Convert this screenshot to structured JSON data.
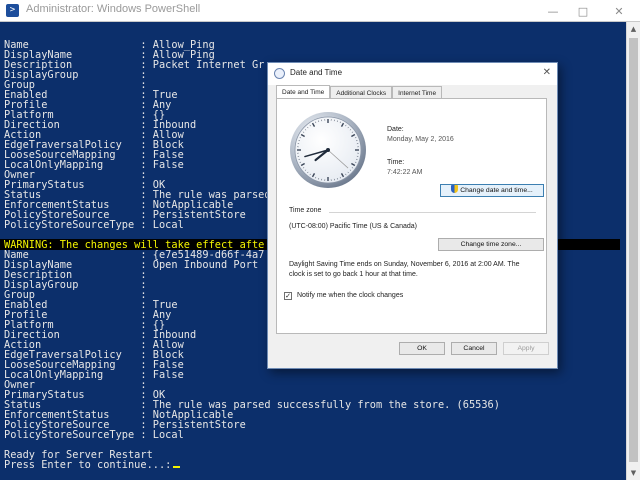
{
  "powershell": {
    "title": "Administrator: Windows PowerShell",
    "lines": [
      "Name                  : Allow_Ping",
      "DisplayName           : Allow Ping",
      "Description           : Packet Internet Gr",
      "DisplayGroup          :",
      "Group                 :",
      "Enabled               : True",
      "Profile               : Any",
      "Platform              : {}",
      "Direction             : Inbound",
      "Action                : Allow",
      "EdgeTraversalPolicy   : Block",
      "LooseSourceMapping    : False",
      "LocalOnlyMapping      : False",
      "Owner                 :",
      "PrimaryStatus         : OK",
      "Status                : The rule was parsed",
      "EnforcementStatus     : NotApplicable",
      "PolicyStoreSource     : PersistentStore",
      "PolicyStoreSourceType : Local",
      "",
      "WARNING: The changes will take effect afte",
      "Name                  : {e7e51489-d66f-4a7",
      "DisplayName           : Open Inbound Port",
      "Description           :",
      "DisplayGroup          :",
      "Group                 :",
      "Enabled               : True",
      "Profile               : Any",
      "Platform              : {}",
      "Direction             : Inbound",
      "Action                : Allow",
      "EdgeTraversalPolicy   : Block",
      "LooseSourceMapping    : False",
      "LocalOnlyMapping      : False",
      "Owner                 :",
      "PrimaryStatus         : OK",
      "Status                : The rule was parsed successfully from the store. (65536)",
      "EnforcementStatus     : NotApplicable",
      "PolicyStoreSource     : PersistentStore",
      "PolicyStoreSourceType : Local",
      "",
      "Ready for Server Restart",
      "Press Enter to continue...:"
    ]
  },
  "dialog": {
    "title": "Date and Time",
    "tabs": [
      "Date and Time",
      "Additional Clocks",
      "Internet Time"
    ],
    "date_label": "Date:",
    "date_value": "Monday, May 2, 2016",
    "time_label": "Time:",
    "time_value": "7:42:22 AM",
    "change_datetime_button": "Change date and time...",
    "timezone_header": "Time zone",
    "timezone_value": "(UTC-08:00) Pacific Time (US & Canada)",
    "change_timezone_button": "Change time zone...",
    "dst_line1": "Daylight Saving Time ends on Sunday, November 6, 2016 at 2:00 AM. The",
    "dst_line2": "clock is set to go back 1 hour at that time.",
    "notify_label": "Notify me when the clock changes",
    "notify_checked": true,
    "ok_button": "OK",
    "cancel_button": "Cancel",
    "apply_button": "Apply"
  },
  "colors": {
    "console_background": "#0c2f6b",
    "console_text": "#e6e6e6",
    "warning_text": "#f4f400"
  },
  "icons": {
    "powershell": "powershell-icon",
    "dialog": "clock-icon",
    "uac": "shield-icon"
  }
}
